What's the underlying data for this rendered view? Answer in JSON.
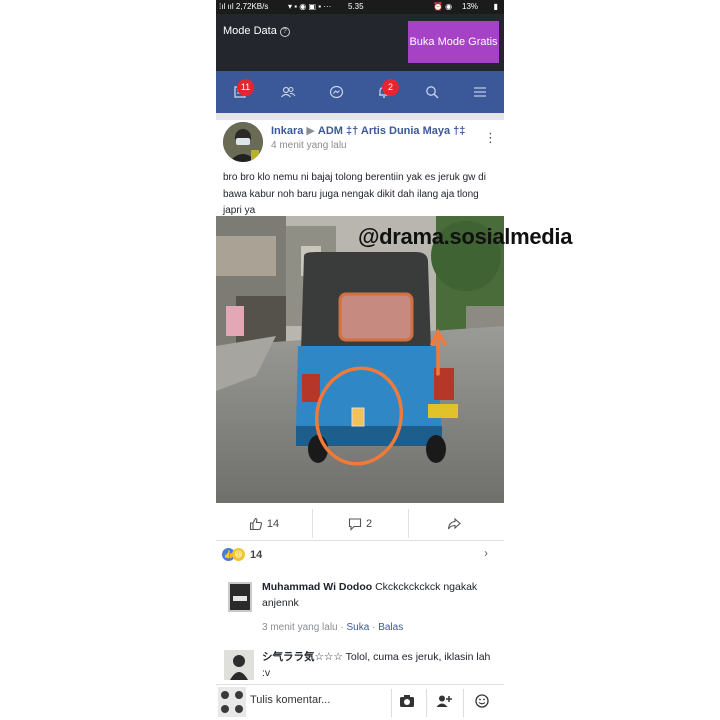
{
  "status": {
    "left": "⁞ıl ııl 2,72KB/s",
    "time": "5.35",
    "battery": "13%"
  },
  "banner": {
    "title": "Mode Data",
    "button": "Buka Mode Gratis"
  },
  "nav": {
    "badge_feed": "11",
    "badge_notifications": "2"
  },
  "post": {
    "author": "Inkara",
    "target": "ADM ‡† Artis Dunia Maya †‡",
    "time": "4 menit yang lalu",
    "text": "bro bro klo nemu ni bajaj tolong berentiin yak es jeruk gw di bawa kabur noh baru juga nengak dikit dah ilang aja tlong japri ya",
    "photo_watermark": "@drama.sosialmedia"
  },
  "actions": {
    "likes": "14",
    "comments": "2"
  },
  "reactions": {
    "count": "14"
  },
  "comments": [
    {
      "name": "Muhammad Wi Dodoo",
      "text": "Ckckckckckck ngakak anjennk",
      "time": "3 menit yang lalu",
      "like": "Suka",
      "reply": "Balas"
    },
    {
      "name": "シ气ララ気☆☆☆",
      "text": "Tolol, cuma es jeruk, iklasin lah :v"
    }
  ],
  "composer": {
    "placeholder": "Tulis komentar..."
  },
  "colors": {
    "nav": "#3b5998",
    "banner_button": "#a542c6",
    "badge": "#e8252f"
  }
}
